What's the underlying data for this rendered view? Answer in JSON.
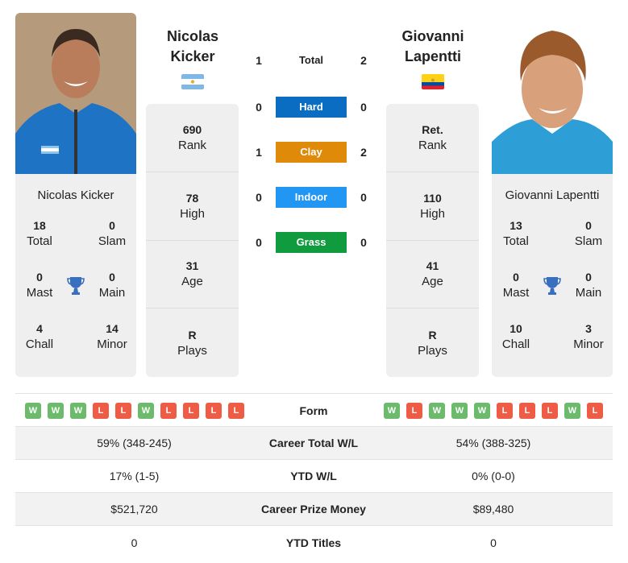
{
  "players": {
    "left": {
      "name_line1": "Nicolas",
      "name_line2": "Kicker",
      "full_name": "Nicolas Kicker",
      "country": "Argentina",
      "flag": "argentina-flag",
      "photo": "player-photo",
      "stats": [
        {
          "value": "690",
          "label": "Rank"
        },
        {
          "value": "78",
          "label": "High"
        },
        {
          "value": "31",
          "label": "Age"
        },
        {
          "value": "R",
          "label": "Plays"
        }
      ],
      "titles": {
        "total": {
          "value": "18",
          "label": "Total"
        },
        "slam": {
          "value": "0",
          "label": "Slam"
        },
        "mast": {
          "value": "0",
          "label": "Mast"
        },
        "main": {
          "value": "0",
          "label": "Main"
        },
        "chall": {
          "value": "4",
          "label": "Chall"
        },
        "minor": {
          "value": "14",
          "label": "Minor"
        }
      },
      "form": [
        "W",
        "W",
        "W",
        "L",
        "L",
        "W",
        "L",
        "L",
        "L",
        "L"
      ]
    },
    "right": {
      "name_line1": "Giovanni",
      "name_line2": "Lapentti",
      "full_name": "Giovanni Lapentti",
      "country": "Ecuador",
      "flag": "ecuador-flag",
      "photo": "player-photo",
      "stats": [
        {
          "value": "Ret.",
          "label": "Rank"
        },
        {
          "value": "110",
          "label": "High"
        },
        {
          "value": "41",
          "label": "Age"
        },
        {
          "value": "R",
          "label": "Plays"
        }
      ],
      "titles": {
        "total": {
          "value": "13",
          "label": "Total"
        },
        "slam": {
          "value": "0",
          "label": "Slam"
        },
        "mast": {
          "value": "0",
          "label": "Mast"
        },
        "main": {
          "value": "0",
          "label": "Main"
        },
        "chall": {
          "value": "10",
          "label": "Chall"
        },
        "minor": {
          "value": "3",
          "label": "Minor"
        }
      },
      "form": [
        "W",
        "L",
        "W",
        "W",
        "W",
        "L",
        "L",
        "L",
        "W",
        "L"
      ]
    }
  },
  "h2h": [
    {
      "label": "Total",
      "left": "1",
      "right": "2",
      "color": ""
    },
    {
      "label": "Hard",
      "left": "0",
      "right": "0",
      "color": "#0a6dc2"
    },
    {
      "label": "Clay",
      "left": "1",
      "right": "2",
      "color": "#e08a0a"
    },
    {
      "label": "Indoor",
      "left": "0",
      "right": "0",
      "color": "#2196f3"
    },
    {
      "label": "Grass",
      "left": "0",
      "right": "0",
      "color": "#0f9b3e"
    }
  ],
  "form_label": "Form",
  "comparison": [
    {
      "label": "Career Total W/L",
      "left": "59% (348-245)",
      "right": "54% (388-325)"
    },
    {
      "label": "YTD W/L",
      "left": "17% (1-5)",
      "right": "0% (0-0)"
    },
    {
      "label": "Career Prize Money",
      "left": "$521,720",
      "right": "$89,480"
    },
    {
      "label": "YTD Titles",
      "left": "0",
      "right": "0"
    }
  ],
  "colors": {
    "win": "#6cbb6c",
    "loss": "#ee5c45",
    "trophy": "#3a6fc0",
    "card_bg": "#efefef"
  }
}
